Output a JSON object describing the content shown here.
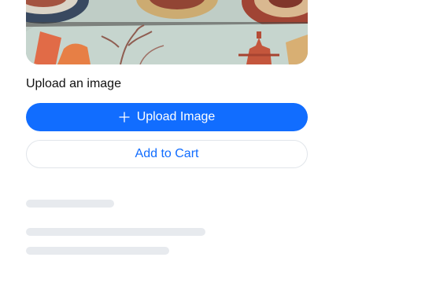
{
  "product": {
    "image_alt": "Decorated painted tiles and ceramic plates"
  },
  "upload": {
    "caption": "Upload an image",
    "button_label": "Upload Image",
    "button_icon": "plus-icon"
  },
  "cart": {
    "button_label": "Add to Cart"
  },
  "colors": {
    "accent": "#116dff",
    "skeleton": "#e7eaee",
    "border": "#e1e5ea"
  }
}
